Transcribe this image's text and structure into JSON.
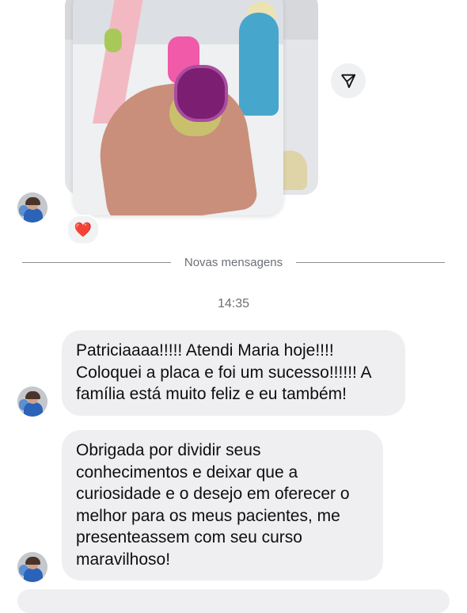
{
  "icons": {
    "share": "paper-plane-icon",
    "reaction": "red-heart-icon"
  },
  "reaction": {
    "emoji": "❤️"
  },
  "divider": {
    "label": "Novas mensagens"
  },
  "timestamp": "14:35",
  "messages": [
    {
      "lines": [
        "Patriciaaaa!!!!! Atendi Maria hoje!!!!",
        "Coloquei a placa e foi um sucesso!!!!!! A",
        "família está muito feliz e eu também!"
      ]
    },
    {
      "lines": [
        "Obrigada por dividir seus",
        "conhecimentos e deixar que a",
        "curiosidade e o desejo em oferecer o",
        "melhor para os meus pacientes, me",
        "presenteassem com seu curso",
        "maravilhoso!"
      ]
    }
  ],
  "colors": {
    "bubble": "#efeff2",
    "text": "#0d0e10",
    "muted": "#6b6f75",
    "divider": "#8a8d92"
  }
}
